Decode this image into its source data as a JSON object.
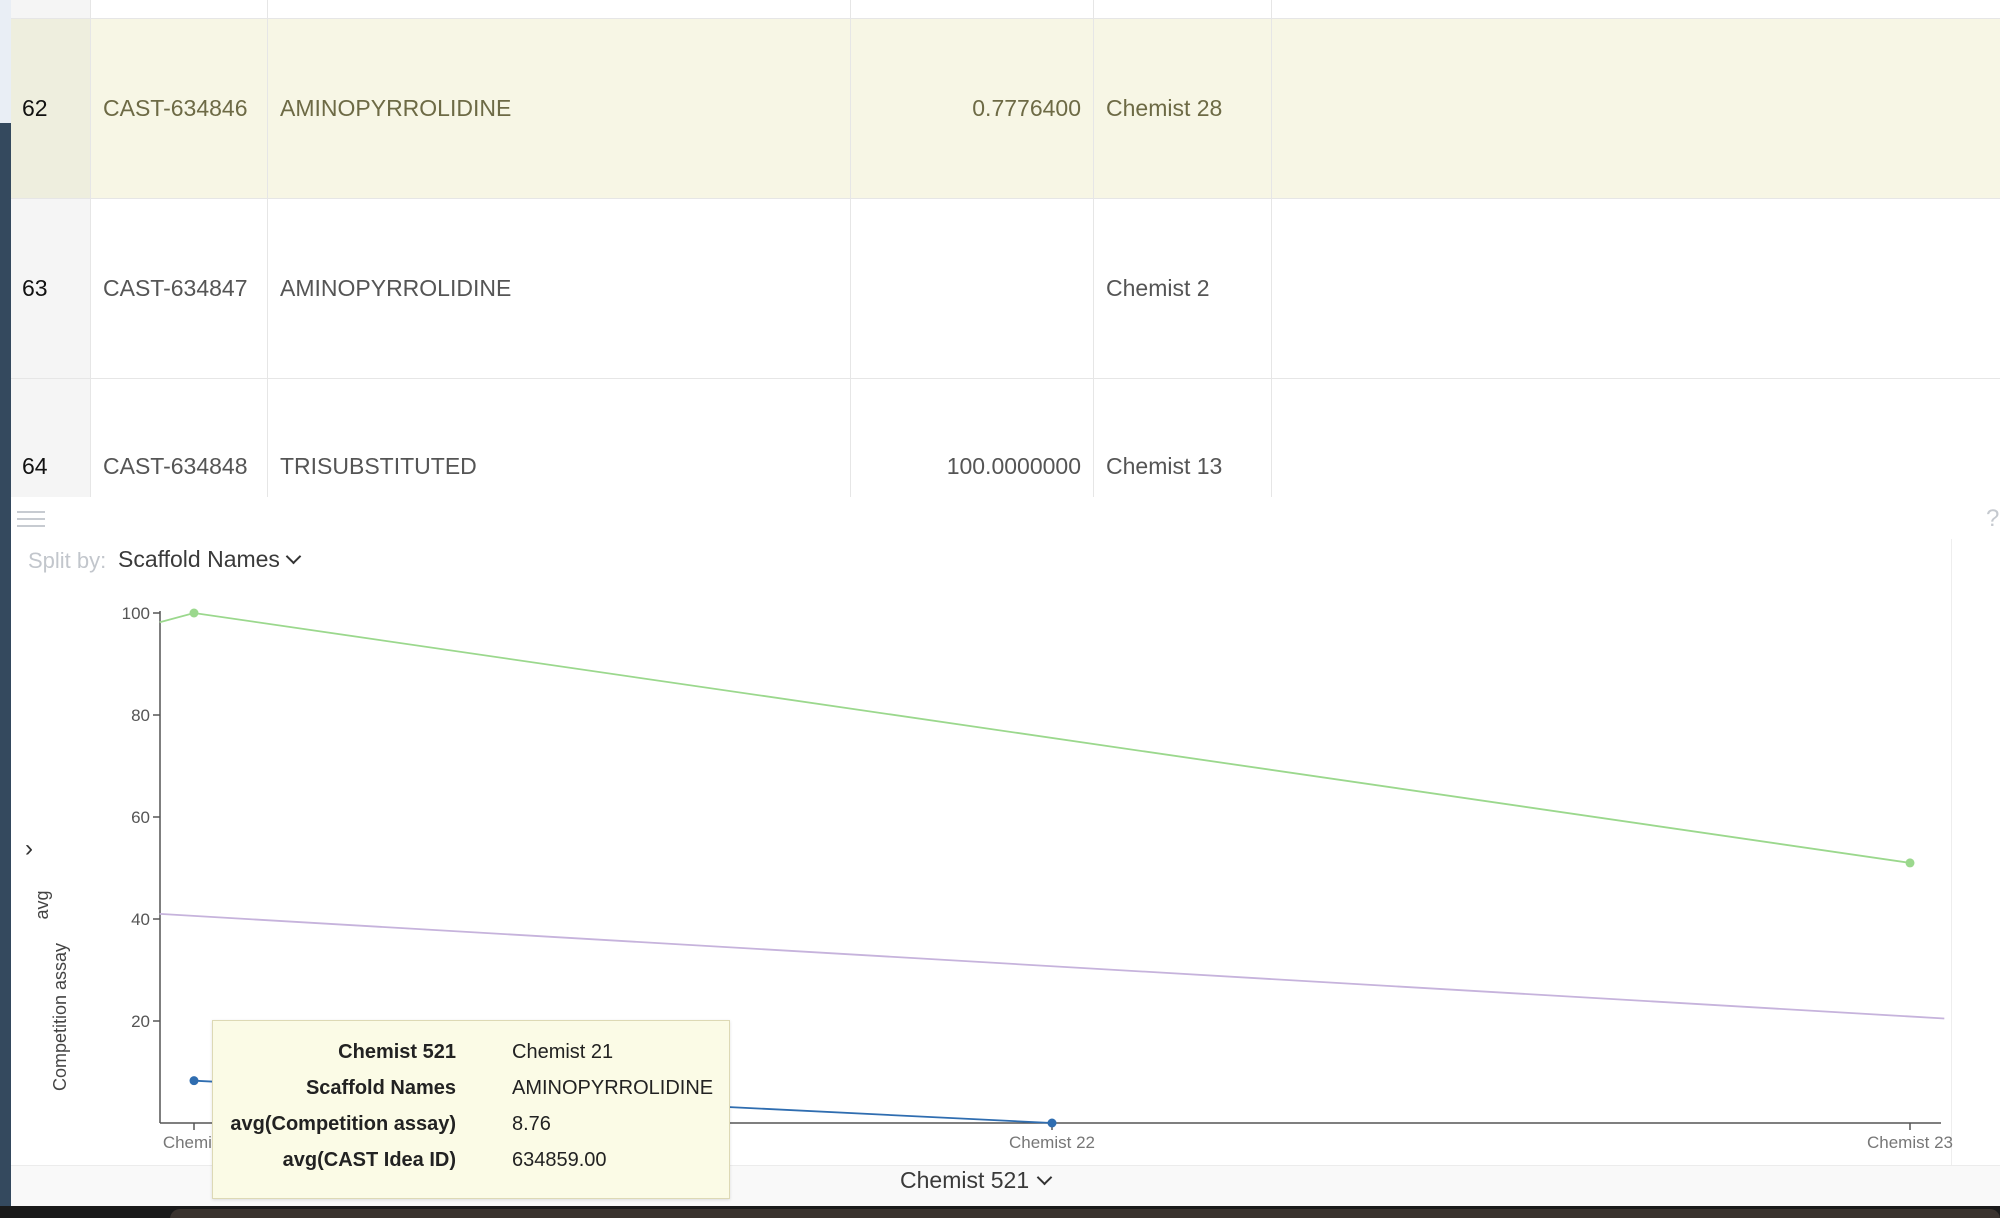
{
  "grid": {
    "rows": [
      {
        "num": "62",
        "id": "CAST-634846",
        "scaffold": "AMINOPYRROLIDINE",
        "assay": "0.7776400",
        "chemist": "Chemist 28",
        "selected": true
      },
      {
        "num": "63",
        "id": "CAST-634847",
        "scaffold": "AMINOPYRROLIDINE",
        "assay": "",
        "chemist": "Chemist 2",
        "selected": false
      },
      {
        "num": "64",
        "id": "CAST-634848",
        "scaffold": "TRISUBSTITUTED",
        "assay": "100.0000000",
        "chemist": "Chemist 13",
        "selected": false
      }
    ]
  },
  "panel": {
    "help_label": "?",
    "split_by_label": "Split by:",
    "split_by_value": "Scaffold Names",
    "expand_label": "›",
    "x_selector": "Chemist 521"
  },
  "chart_data": {
    "type": "line",
    "categories": [
      "Chemist 21",
      "Chemist 22",
      "Chemist 23"
    ],
    "x_tick_labels": [
      "Chemist",
      "Chemist 22",
      "Chemist 23"
    ],
    "ylabel_lines": [
      "avg",
      "Competition assay"
    ],
    "yticks": [
      20,
      40,
      60,
      80,
      100
    ],
    "ylim": [
      0,
      100
    ],
    "grid": false,
    "series": [
      {
        "color": "#9bd88d",
        "x": [
          -0.04,
          0,
          2
        ],
        "y": [
          98.2,
          100,
          51
        ],
        "markers": [
          1,
          2
        ]
      },
      {
        "color": "#c6b3dc",
        "x": [
          -0.04,
          2.04
        ],
        "y": [
          41,
          20.5
        ],
        "markers": []
      },
      {
        "color": "#2f6db0",
        "x": [
          0,
          1
        ],
        "y": [
          8.3,
          0
        ],
        "markers": [
          0,
          1
        ]
      }
    ]
  },
  "tooltip": {
    "rows": [
      {
        "key": "Chemist 521",
        "value": "Chemist 21"
      },
      {
        "key": "Scaffold Names",
        "value": "AMINOPYRROLIDINE"
      },
      {
        "key": "avg(Competition assay)",
        "value": "8.76"
      },
      {
        "key": "avg(CAST Idea ID)",
        "value": "634859.00"
      }
    ]
  }
}
